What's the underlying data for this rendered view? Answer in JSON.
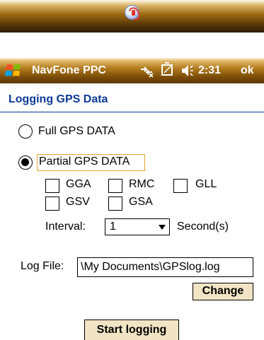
{
  "top_bar": {
    "logo_icon": "navfone-logo-icon"
  },
  "title_bar": {
    "app_title": "NavFone PPC",
    "time": "2:31",
    "ok_label": "ok",
    "icons": [
      "windows-start-icon",
      "connectivity-icon",
      "battery-icon",
      "speaker-icon"
    ]
  },
  "page": {
    "title": "Logging GPS Data",
    "title_color": "#0b3a96",
    "options": {
      "full_label": "Full GPS DATA",
      "full_checked": false,
      "partial_label": "Partial GPS DATA",
      "partial_checked": true
    },
    "sentences": {
      "gga": "GGA",
      "rmc": "RMC",
      "gll": "GLL",
      "gsv": "GSV",
      "gsa": "GSA"
    },
    "interval": {
      "label": "Interval:",
      "value": "1",
      "unit": "Second(s)"
    },
    "log_file": {
      "label": "Log File:",
      "value": "\\My Documents\\GPSlog.log"
    },
    "change_button": "Change",
    "start_button": "Start logging"
  },
  "colors": {
    "title_bar_brown": "#8a5810",
    "button_bg": "#f1e4c4",
    "focus_border": "#e1a730"
  }
}
